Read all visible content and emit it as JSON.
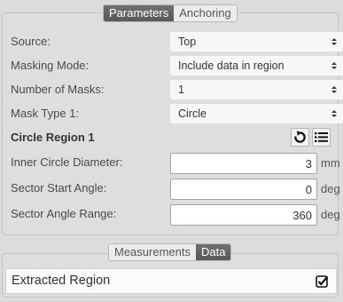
{
  "top_tabs": {
    "parameters": "Parameters",
    "anchoring": "Anchoring"
  },
  "fields": {
    "source": {
      "label": "Source:",
      "value": "Top"
    },
    "masking_mode": {
      "label": "Masking Mode:",
      "value": "Include data in region"
    },
    "num_masks": {
      "label": "Number of Masks:",
      "value": "1"
    },
    "mask_type": {
      "label": "Mask Type 1:",
      "value": "Circle"
    }
  },
  "circle_region": {
    "title": "Circle Region 1",
    "reset_icon": "reset-icon",
    "list_icon": "list-icon"
  },
  "numeric": {
    "inner_diameter": {
      "label": "Inner Circle Diameter:",
      "value": "3",
      "unit": "mm"
    },
    "sector_start": {
      "label": "Sector Start Angle:",
      "value": "0",
      "unit": "deg"
    },
    "sector_range": {
      "label": "Sector Angle Range:",
      "value": "360",
      "unit": "deg"
    }
  },
  "bottom_tabs": {
    "measurements": "Measurements",
    "data": "Data"
  },
  "data_list": {
    "item": "Extracted Region",
    "checked": true
  }
}
